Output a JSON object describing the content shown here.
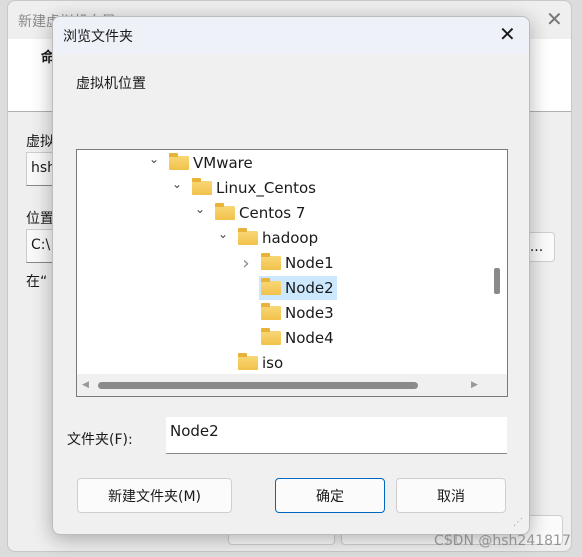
{
  "background_window": {
    "title": "新建虚拟机向导",
    "tab_fragment": "命",
    "name_label": "虚拟",
    "name_value": "hsh",
    "location_label": "位置",
    "location_value": "C:\\",
    "hint": "在“",
    "browse_label": "..."
  },
  "dialog": {
    "title": "浏览文件夹",
    "prompt": "虚拟机位置",
    "tree": [
      {
        "label": "VMware",
        "level": 0,
        "expander": "expanded"
      },
      {
        "label": "Linux_Centos",
        "level": 1,
        "expander": "expanded"
      },
      {
        "label": "Centos 7",
        "level": 2,
        "expander": "expanded"
      },
      {
        "label": "hadoop",
        "level": 3,
        "expander": "expanded"
      },
      {
        "label": "Node1",
        "level": 4,
        "expander": "collapsed"
      },
      {
        "label": "Node2",
        "level": 4,
        "expander": "none",
        "selected": true
      },
      {
        "label": "Node3",
        "level": 4,
        "expander": "none"
      },
      {
        "label": "Node4",
        "level": 4,
        "expander": "none"
      },
      {
        "label": "iso",
        "level": 3,
        "expander": "none"
      }
    ],
    "folder_label": "文件夹(F):",
    "folder_value": "Node2",
    "new_folder_button": "新建文件夹(M)",
    "ok_button": "确定",
    "cancel_button": "取消"
  },
  "watermark": "CSDN @hsh241817",
  "colors": {
    "selection": "#cce8ff",
    "accent": "#0067c0"
  }
}
